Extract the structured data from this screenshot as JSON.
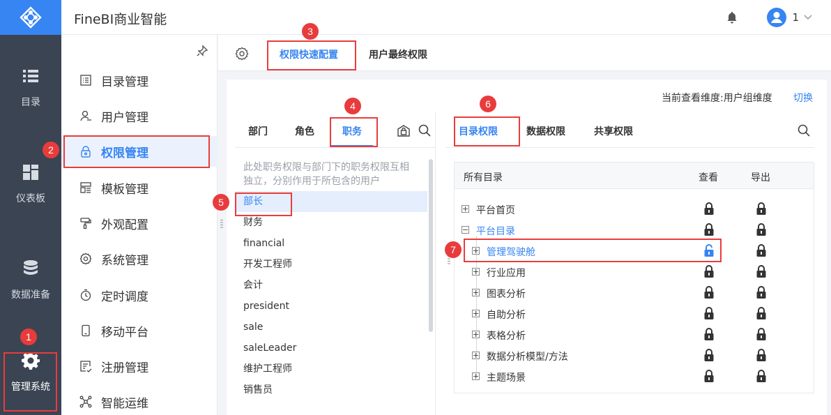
{
  "app": {
    "title": "FineBI商业智能",
    "user_initial_count": "1"
  },
  "rail": [
    {
      "label": "目录",
      "icon": "list-icon"
    },
    {
      "label": "仪表板",
      "icon": "dashboard-icon"
    },
    {
      "label": "数据准备",
      "icon": "database-icon"
    },
    {
      "label": "管理系统",
      "icon": "gear-icon",
      "active": true
    }
  ],
  "subnav": [
    {
      "label": "目录管理",
      "icon": "catalog-icon"
    },
    {
      "label": "用户管理",
      "icon": "user-icon"
    },
    {
      "label": "权限管理",
      "icon": "lock-icon",
      "active": true
    },
    {
      "label": "模板管理",
      "icon": "template-icon"
    },
    {
      "label": "外观配置",
      "icon": "brush-icon"
    },
    {
      "label": "系统管理",
      "icon": "settings-icon"
    },
    {
      "label": "定时调度",
      "icon": "timer-icon"
    },
    {
      "label": "移动平台",
      "icon": "mobile-icon"
    },
    {
      "label": "注册管理",
      "icon": "register-icon"
    },
    {
      "label": "智能运维",
      "icon": "ops-icon"
    }
  ],
  "content_tabs": {
    "quick": "权限快速配置",
    "final": "用户最终权限"
  },
  "dimension": {
    "text": "当前查看维度:用户组维度",
    "switch": "切换"
  },
  "left_tabs": {
    "dept": "部门",
    "role": "角色",
    "post": "职务"
  },
  "hint": "此处职务权限与部门下的职务权限互相独立，分别作用于所包含的用户",
  "posts": [
    "部长",
    "财务",
    "financial",
    "开发工程师",
    "会计",
    "president",
    "sale",
    "saleLeader",
    "维护工程师",
    "销售员"
  ],
  "right_tabs": {
    "catalog": "目录权限",
    "data": "数据权限",
    "share": "共享权限"
  },
  "table": {
    "col_name": "所有目录",
    "col_view": "查看",
    "col_export": "导出",
    "rows": [
      {
        "label": "平台首页",
        "level": 0,
        "expander": "plus",
        "blue": false
      },
      {
        "label": "平台目录",
        "level": 0,
        "expander": "minus",
        "blue": true
      },
      {
        "label": "管理驾驶舱",
        "level": 1,
        "expander": "plus",
        "blue": true,
        "view_unlocked": true
      },
      {
        "label": "行业应用",
        "level": 1,
        "expander": "plus",
        "blue": false
      },
      {
        "label": "图表分析",
        "level": 1,
        "expander": "plus",
        "blue": false
      },
      {
        "label": "自助分析",
        "level": 1,
        "expander": "plus",
        "blue": false
      },
      {
        "label": "表格分析",
        "level": 1,
        "expander": "plus",
        "blue": false
      },
      {
        "label": "数据分析模型/方法",
        "level": 1,
        "expander": "plus",
        "blue": false
      },
      {
        "label": "主题场景",
        "level": 1,
        "expander": "plus",
        "blue": false
      }
    ]
  },
  "badges": [
    "1",
    "2",
    "3",
    "4",
    "5",
    "6",
    "7"
  ],
  "colors": {
    "accent": "#3685f2",
    "rail": "#3b4453",
    "annotation": "#e83c3c"
  }
}
